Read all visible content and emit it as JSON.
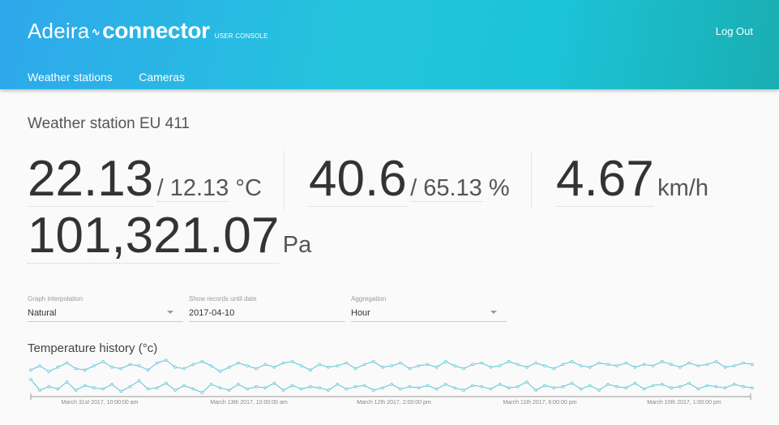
{
  "header": {
    "brand": "Adeira",
    "tilde": "∿",
    "product": "connector",
    "console_label": "USER CONSOLE",
    "logout": "Log Out",
    "nav": [
      "Weather stations",
      "Cameras"
    ],
    "colors": {
      "gradient_start": "#2fa8ec",
      "gradient_end": "#1aaeb2"
    }
  },
  "page": {
    "title": "Weather station EU 411"
  },
  "metrics": {
    "temperature": {
      "value": "22.13",
      "secondary": "/ 12.13",
      "unit": "°C"
    },
    "humidity": {
      "value": "40.6",
      "secondary": "/ 65.13",
      "unit": "%"
    },
    "wind": {
      "value": "4.67",
      "unit": "km/h"
    },
    "pressure": {
      "value": "101,321.07",
      "unit": "Pa"
    }
  },
  "controls": {
    "interpolation": {
      "label": "Graph interpolation",
      "value": "Natural"
    },
    "until_date": {
      "label": "Show records until date",
      "value": "2017-04-10"
    },
    "aggregation": {
      "label": "Aggregation",
      "value": "Hour"
    }
  },
  "graph": {
    "title": "Temperature history (°c)",
    "line_color": "#5cc4d9",
    "x_ticks": [
      "March 31st 2017, 10:00:00 am",
      "March 13th 2017, 10:00:00 am",
      "March 12th 2017, 2:00:00 pm",
      "March 11th 2017, 6:00:00 pm",
      "March 10th 2017, 1:00:00 pm"
    ]
  },
  "chart_data": {
    "type": "line",
    "title": "Temperature history (°c)",
    "x_tick_labels": [
      "March 31st 2017, 10:00:00 am",
      "March 13th 2017, 10:00:00 am",
      "March 12th 2017, 2:00:00 pm",
      "March 11th 2017, 6:00:00 pm",
      "March 10th 2017, 1:00:00 pm"
    ],
    "series": [
      {
        "values": [
          20.3,
          20.6,
          20.2,
          20.5,
          20.8,
          20.4,
          20.3,
          20.6,
          20.9,
          20.5,
          20.4,
          20.7,
          20.6,
          20.3,
          20.8,
          21.0,
          20.5,
          20.4,
          20.7,
          20.9,
          20.6,
          20.2,
          20.5,
          20.8,
          20.6,
          20.4,
          20.7,
          20.5,
          20.8,
          20.9,
          20.6,
          20.3,
          20.7,
          20.5,
          20.6,
          20.8,
          20.4,
          20.7,
          20.9,
          20.5,
          20.6,
          20.8,
          20.4,
          20.6,
          20.7,
          20.5,
          20.9,
          20.6,
          20.4,
          20.7,
          20.8,
          20.5,
          20.6,
          20.9,
          20.7,
          20.5,
          20.8,
          20.6,
          20.4,
          20.7,
          20.9,
          20.6,
          20.5,
          20.8,
          20.7,
          20.6,
          20.8,
          20.5,
          20.7,
          20.6,
          20.9,
          20.7,
          20.5,
          20.8,
          20.6,
          20.7,
          20.9,
          20.5,
          20.6,
          20.8,
          20.7
        ]
      },
      {
        "values": [
          13.0,
          12.1,
          12.4,
          12.2,
          12.8,
          12.1,
          12.5,
          12.3,
          12.2,
          12.6,
          12.0,
          12.4,
          12.9,
          12.2,
          12.3,
          12.7,
          12.1,
          12.5,
          12.2,
          11.9,
          12.6,
          12.3,
          12.1,
          12.6,
          12.2,
          12.4,
          12.3,
          12.7,
          12.1,
          12.5,
          12.2,
          12.4,
          12.3,
          12.1,
          12.6,
          12.2,
          12.4,
          12.5,
          12.1,
          12.3,
          12.6,
          12.2,
          12.4,
          12.3,
          12.5,
          12.2,
          12.6,
          12.3,
          12.1,
          12.5,
          12.4,
          12.2,
          12.6,
          12.3,
          12.4,
          12.8,
          12.1,
          12.5,
          12.3,
          12.4,
          12.7,
          12.2,
          12.5,
          12.1,
          12.6,
          12.4,
          12.3,
          12.7,
          12.2,
          12.5,
          12.6,
          12.3,
          12.4,
          12.7,
          12.2,
          12.5,
          12.4,
          12.3,
          12.6,
          12.4,
          12.3
        ]
      }
    ]
  }
}
